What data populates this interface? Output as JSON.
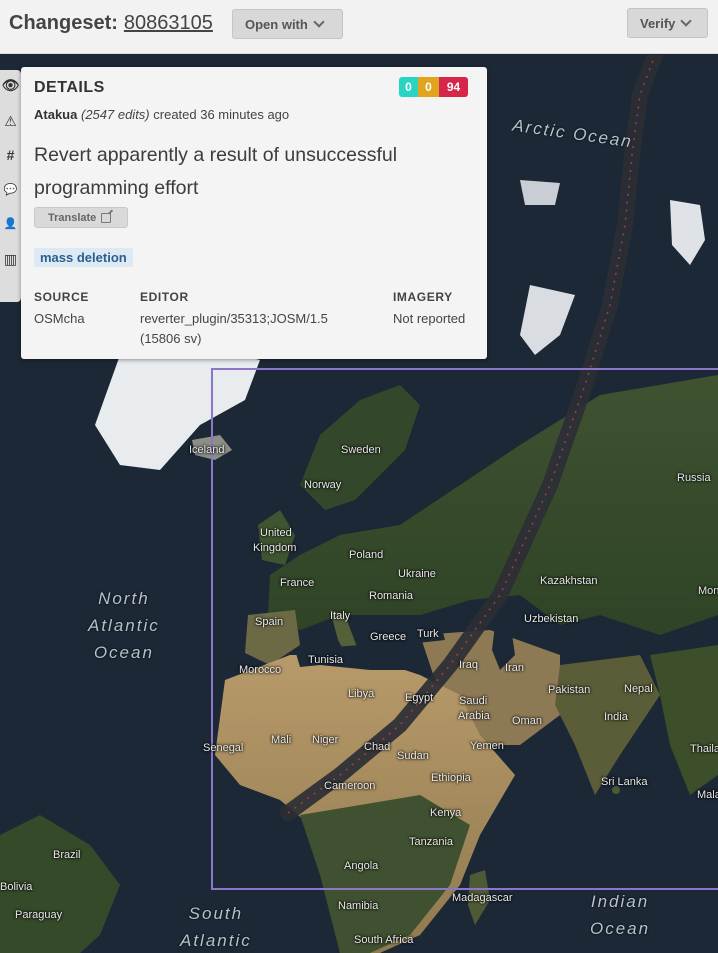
{
  "header": {
    "title_prefix": "Changeset:",
    "changeset_id": "80863105",
    "open_with_label": "Open with",
    "verify_label": "Verify"
  },
  "sidebar": {
    "tools": [
      {
        "icon": "eye-icon",
        "glyph": "👁"
      },
      {
        "icon": "warning-icon",
        "glyph": "⚠"
      },
      {
        "icon": "hash-icon",
        "glyph": "#"
      },
      {
        "icon": "comment-icon",
        "glyph": "💬"
      },
      {
        "icon": "user-icon",
        "glyph": "👤"
      },
      {
        "icon": "map-icon",
        "glyph": "▥"
      }
    ]
  },
  "details": {
    "title": "DETAILS",
    "counts": {
      "added": "0",
      "modified": "0",
      "deleted": "94"
    },
    "colors": {
      "added": "#2ad4c3",
      "modified": "#e0a41e",
      "deleted": "#d6264a"
    },
    "user": "Atakua",
    "edits": "(2547 edits)",
    "created": "created 36 minutes ago",
    "comment": "Revert apparently a result of unsuccessful programming effort",
    "translate_label": "Translate",
    "tag": "mass deletion",
    "source_label": "SOURCE",
    "source_value": "OSMcha",
    "editor_label": "EDITOR",
    "editor_value": "reverter_plugin/35313;JOSM/1.5",
    "editor_sub": "(15806 sv)",
    "imagery_label": "IMAGERY",
    "imagery_value": "Not reported"
  },
  "map": {
    "oceans": [
      {
        "line1": "North",
        "line2": "Atlantic",
        "line3": "Ocean"
      },
      {
        "line1": "Arctic Ocean"
      },
      {
        "line1": "Indian",
        "line2": "Ocean"
      },
      {
        "line1": "South",
        "line2": "Atlantic"
      }
    ],
    "labels": {
      "iceland": "Iceland",
      "sweden": "Sweden",
      "norway": "Norway",
      "uk": "United",
      "uk2": "Kingdom",
      "poland": "Poland",
      "ukraine": "Ukraine",
      "france": "France",
      "romania": "Romania",
      "kazakhstan": "Kazakhstan",
      "spain": "Spain",
      "italy": "Italy",
      "greece": "Greece",
      "turkey": "Turk",
      "uzbekistan": "Uzbekistan",
      "morocco": "Morocco",
      "tunisia": "Tunisia",
      "iraq": "Iraq",
      "iran": "Iran",
      "libya": "Libya",
      "egypt": "Egypt",
      "saudi": "Saudi",
      "saudi2": "Arabia",
      "oman": "Oman",
      "pakistan": "Pakistan",
      "nepal": "Nepal",
      "india": "India",
      "senegal": "Senegal",
      "mali": "Mali",
      "niger": "Niger",
      "chad": "Chad",
      "sudan": "Sudan",
      "yemen": "Yemen",
      "ethiopia": "Ethiopia",
      "cameroon": "Cameroon",
      "kenya": "Kenya",
      "tanzania": "Tanzania",
      "angola": "Angola",
      "namibia": "Namibia",
      "madagascar": "Madagascar",
      "southafrica": "South Africa",
      "brazil": "Brazil",
      "bolivia": "Bolivia",
      "paraguay": "Paraguay",
      "srilanka": "Sri Lanka",
      "russia": "Russia",
      "mongolia": "Mon",
      "thailand": "Thaila",
      "malaysia": "Mala"
    }
  }
}
